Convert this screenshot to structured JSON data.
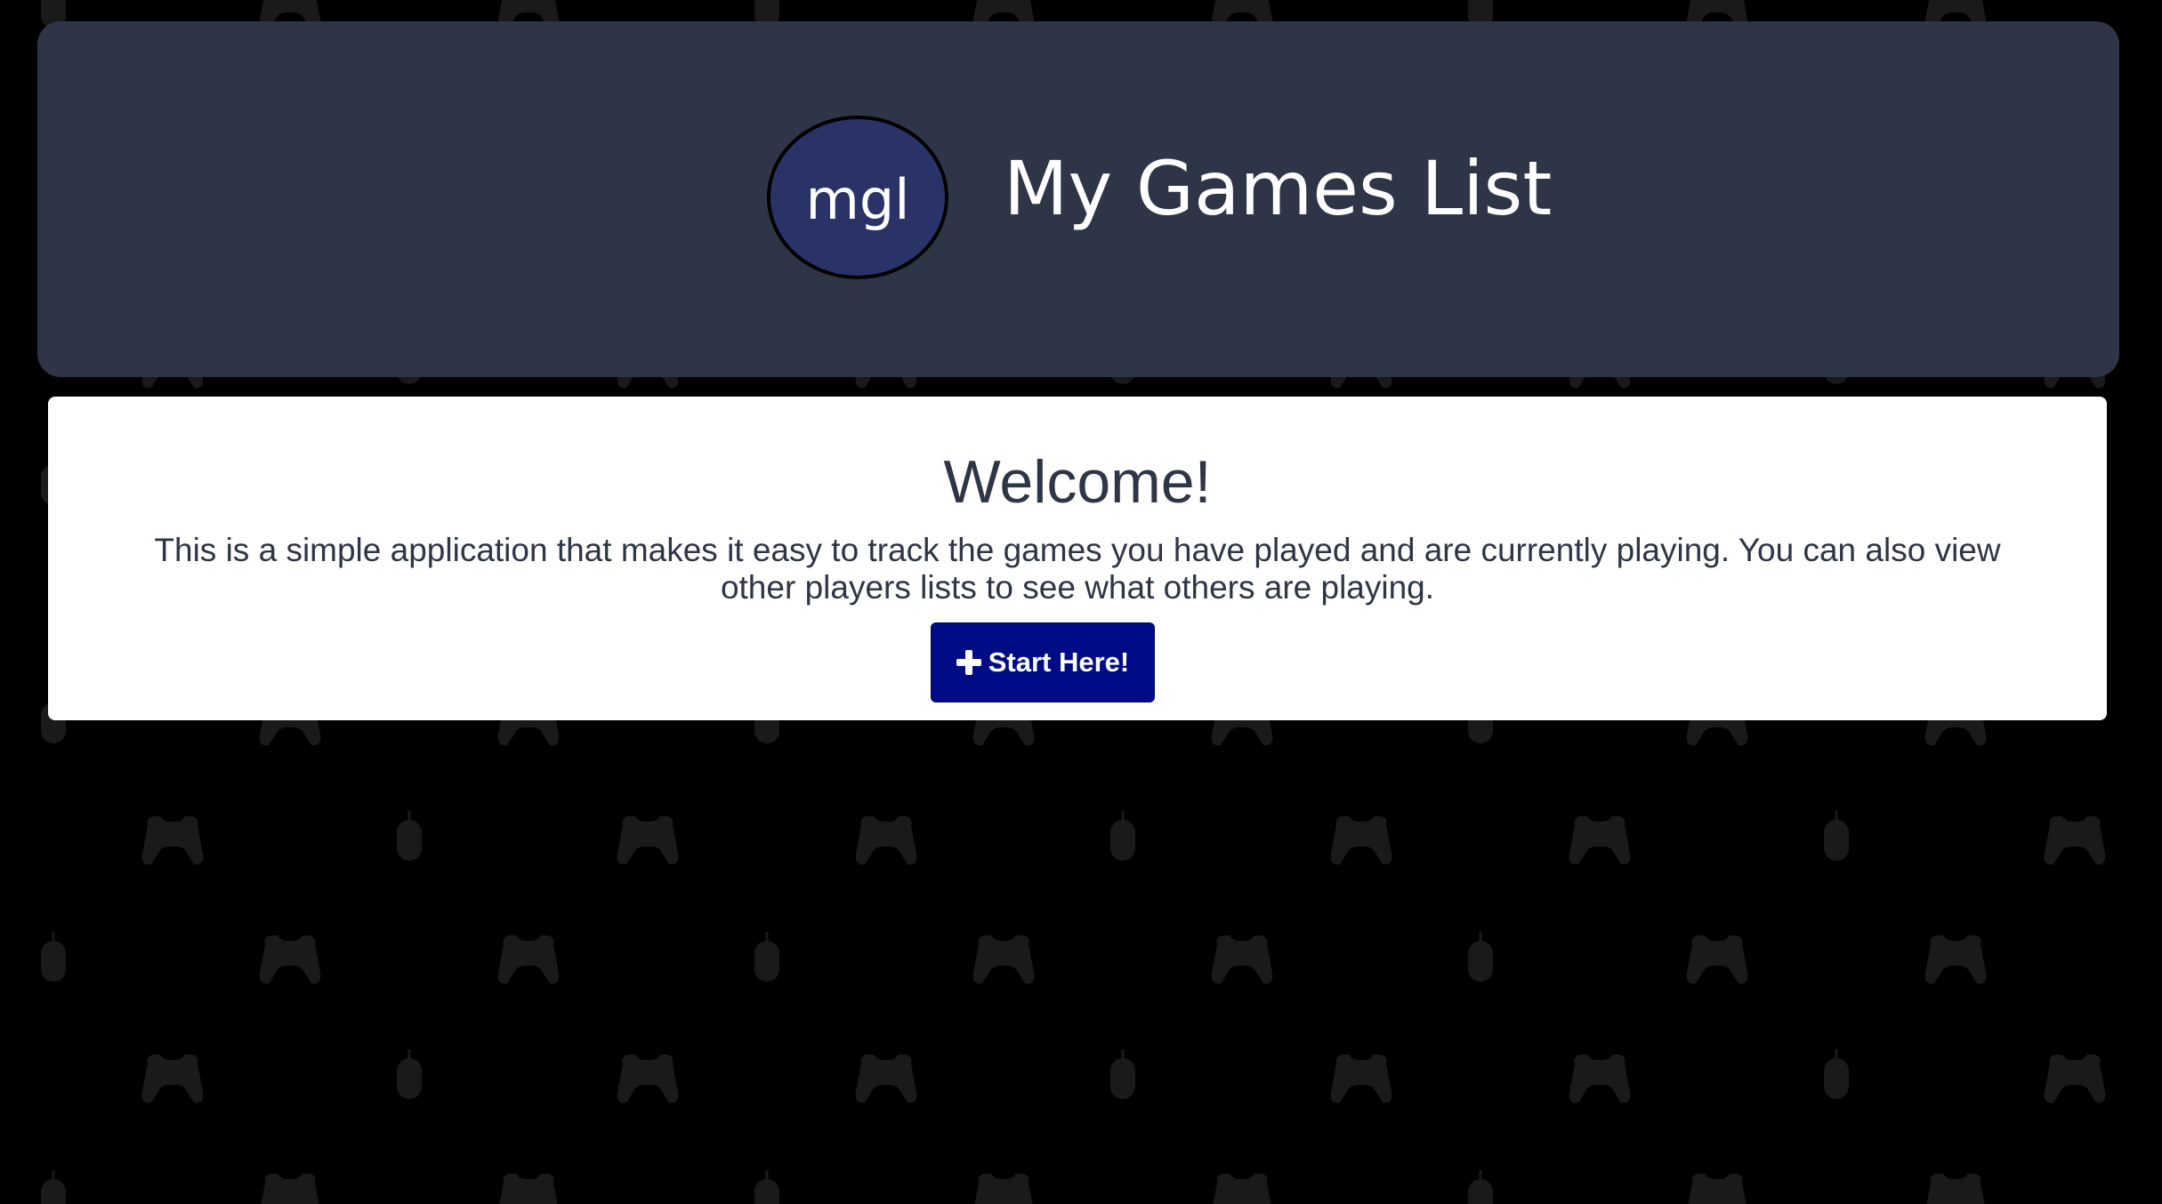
{
  "header": {
    "logo_text": "mgl",
    "title": "My Games List"
  },
  "welcome": {
    "heading": "Welcome!",
    "description": "This is a simple application that makes it easy to track the games you have played and are currently playing. You can also view other players lists to see what others are playing.",
    "button_label": "Start Here!",
    "button_icon": "plus-icon"
  },
  "background": {
    "pattern_icons": [
      "gamepad-icon",
      "mouse-icon"
    ]
  },
  "colors": {
    "page_background": "#000000",
    "pattern": "#1a1a1a",
    "header_background": "#2e3546",
    "logo_background": "#2a3368",
    "card_background": "#ffffff",
    "text_dark": "#2e3546",
    "button_background": "#000b86"
  }
}
